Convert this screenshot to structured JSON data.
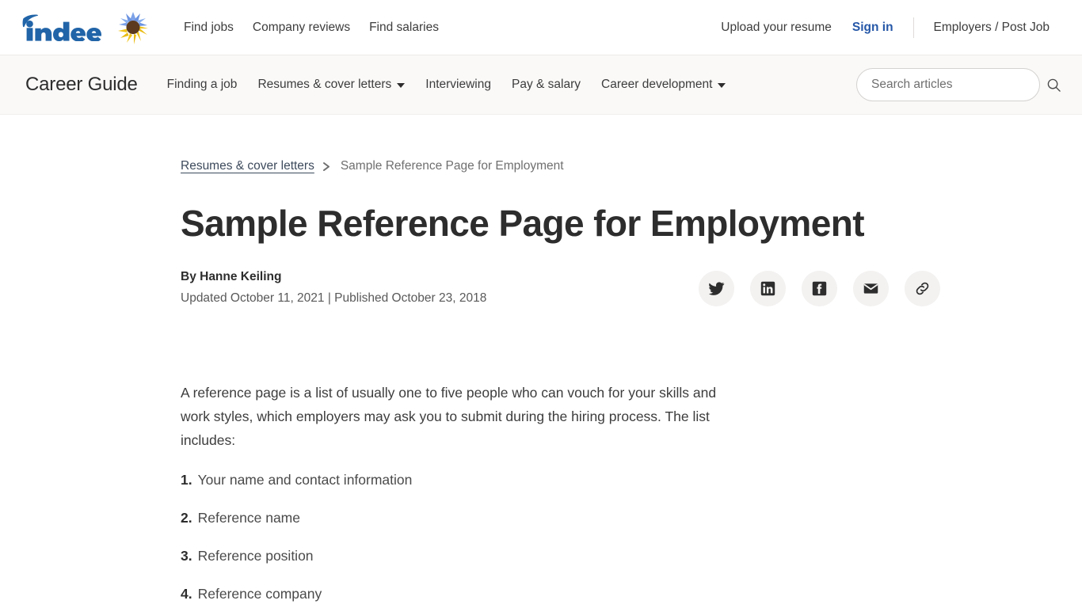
{
  "header": {
    "logo_text": "indeed",
    "logo_icon": "sunflower-icon",
    "nav": [
      {
        "label": "Find jobs"
      },
      {
        "label": "Company reviews"
      },
      {
        "label": "Find salaries"
      }
    ],
    "upload_resume": "Upload your resume",
    "sign_in": "Sign in",
    "employers": "Employers / Post Job"
  },
  "guidebar": {
    "title": "Career Guide",
    "nav": [
      {
        "label": "Finding a job",
        "caret": false
      },
      {
        "label": "Resumes & cover letters",
        "caret": true
      },
      {
        "label": "Interviewing",
        "caret": false
      },
      {
        "label": "Pay & salary",
        "caret": false
      },
      {
        "label": "Career development",
        "caret": true
      }
    ],
    "search": {
      "placeholder": "Search articles",
      "value": "",
      "icon": "search-icon"
    }
  },
  "breadcrumb": {
    "parent": "Resumes & cover letters",
    "separator": "chevron-right-icon",
    "current": "Sample Reference Page for Employment"
  },
  "article": {
    "title": "Sample Reference Page for Employment",
    "author": "By Hanne Keiling",
    "dates": "Updated October 11, 2021 | Published October 23, 2018",
    "intro": "A reference page is a list of usually one to five people who can vouch for your skills and work styles, which employers may ask you to submit during the hiring process. The list includes:",
    "list": [
      {
        "num": "1.",
        "text": "Your name and contact information"
      },
      {
        "num": "2.",
        "text": "Reference name"
      },
      {
        "num": "3.",
        "text": "Reference position"
      },
      {
        "num": "4.",
        "text": "Reference company"
      }
    ],
    "share": [
      {
        "name": "twitter-icon",
        "label": "Share on Twitter"
      },
      {
        "name": "linkedin-icon",
        "label": "Share on LinkedIn"
      },
      {
        "name": "facebook-icon",
        "label": "Share on Facebook"
      },
      {
        "name": "email-icon",
        "label": "Share by email"
      },
      {
        "name": "link-icon",
        "label": "Copy link"
      }
    ]
  },
  "colors": {
    "brand_blue": "#2557a7",
    "text_dark": "#2d2d2d",
    "text_muted": "#6f6f6f",
    "bar_bg": "#faf9f8",
    "share_bg": "#f3f2f1",
    "sunflower_blue": "#6c93e8",
    "sunflower_yellow": "#f0c419",
    "sunflower_center": "#5b3a1e"
  }
}
